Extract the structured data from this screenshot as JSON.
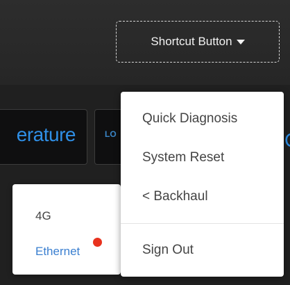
{
  "header": {
    "shortcut_button": {
      "label": "Shortcut Button",
      "icon": "caret-down-icon"
    }
  },
  "tiles": [
    {
      "label": "erature"
    },
    {
      "icon_text": "LO"
    }
  ],
  "edge_fragment": "C",
  "dropdown_menu": {
    "items": [
      {
        "label": "Quick Diagnosis"
      },
      {
        "label": "System Reset"
      },
      {
        "label": "< Backhaul"
      },
      {
        "label": "Sign Out"
      }
    ]
  },
  "backhaul_submenu": {
    "items": [
      {
        "label": "4G"
      },
      {
        "label": "Ethernet",
        "badge_color": "#e8321e"
      }
    ]
  },
  "colors": {
    "accent_blue": "#2f8fe6",
    "link_blue": "#3a7fd0",
    "badge_red": "#e8321e"
  }
}
